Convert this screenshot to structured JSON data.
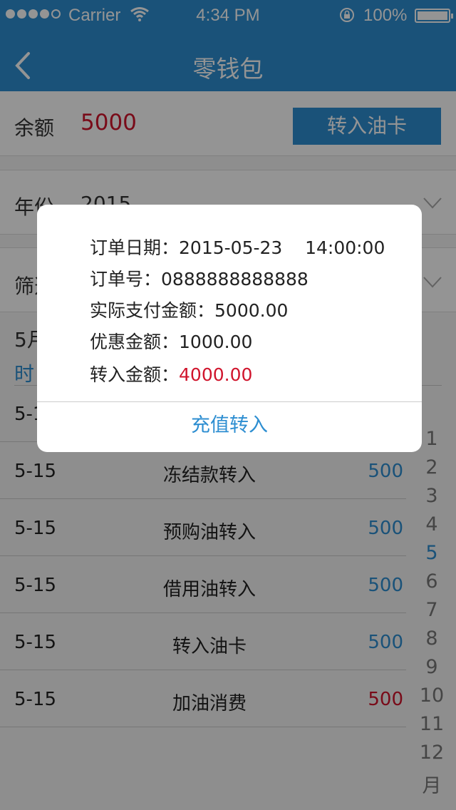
{
  "status_bar": {
    "carrier": "Carrier",
    "time": "4:34 PM",
    "battery": "100%"
  },
  "nav": {
    "title": "零钱包",
    "back_icon": "chevron-left-icon"
  },
  "balance": {
    "label": "余额",
    "value": "5000",
    "button": "转入油卡"
  },
  "year": {
    "label": "年份",
    "value": "2015"
  },
  "filter": {
    "label": "筛选"
  },
  "month_header": "5月",
  "time_column": "时",
  "list": [
    {
      "date": "5-15",
      "type": "",
      "amount": "",
      "color": "#2d8ed1"
    },
    {
      "date": "5-15",
      "type": "冻结款转入",
      "amount": "500",
      "color": "#2d8ed1"
    },
    {
      "date": "5-15",
      "type": "预购油转入",
      "amount": "500",
      "color": "#2d8ed1"
    },
    {
      "date": "5-15",
      "type": "借用油转入",
      "amount": "500",
      "color": "#2d8ed1"
    },
    {
      "date": "5-15",
      "type": "转入油卡",
      "amount": "500",
      "color": "#2d8ed1"
    },
    {
      "date": "5-15",
      "type": "加油消费",
      "amount": "500",
      "color": "#d0142c"
    }
  ],
  "month_index": [
    "1",
    "2",
    "3",
    "4",
    "5",
    "6",
    "7",
    "8",
    "9",
    "10",
    "11",
    "12",
    "月"
  ],
  "active_month": "5",
  "dialog": {
    "order_date_label": "订单日期：",
    "order_date_value": "2015-05-23    14:00:00",
    "order_no_label": "订单号：",
    "order_no_value": "0888888888888",
    "paid_label": "实际支付金额：",
    "paid_value": "5000.00",
    "discount_label": "优惠金额：",
    "discount_value": "1000.00",
    "transfer_label": "转入金额：",
    "transfer_value": "4000.00",
    "button": "充值转入"
  },
  "colors": {
    "accent": "#2d8ed1",
    "red": "#d0142c"
  }
}
